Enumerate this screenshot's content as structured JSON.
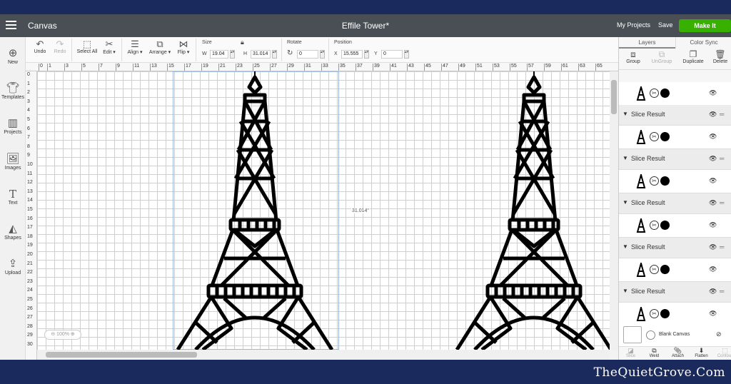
{
  "topbar": {
    "app_title": "Canvas",
    "document_title": "Effile Tower*",
    "my_projects": "My Projects",
    "save": "Save",
    "make_it": "Make It",
    "make_it_color": "#38b000"
  },
  "toolbar": {
    "undo": "Undo",
    "redo": "Redo",
    "select_all": "Select All",
    "edit": "Edit",
    "align": "Align",
    "arrange": "Arrange",
    "flip": "Flip",
    "size_label": "Size",
    "w_label": "W",
    "w_value": "19.04",
    "h_label": "H",
    "h_value": "31.014",
    "rotate_label": "Rotate",
    "rotate_value": "0",
    "position_label": "Position",
    "x_label": "X",
    "x_value": "15.555",
    "y_label": "Y",
    "y_value": "0"
  },
  "leftnav": {
    "items": [
      {
        "label": "New",
        "icon": "plus-circle-icon"
      },
      {
        "label": "Templates",
        "icon": "shirt-icon"
      },
      {
        "label": "Projects",
        "icon": "projects-icon"
      },
      {
        "label": "Images",
        "icon": "image-icon"
      },
      {
        "label": "Text",
        "icon": "text-icon"
      },
      {
        "label": "Shapes",
        "icon": "shapes-icon"
      },
      {
        "label": "Upload",
        "icon": "upload-icon"
      }
    ]
  },
  "rulers": {
    "h_ticks": [
      "0",
      "1",
      "3",
      "5",
      "7",
      "9",
      "11",
      "13",
      "15",
      "17",
      "19",
      "21",
      "23",
      "25",
      "27",
      "29",
      "31",
      "33",
      "35",
      "37",
      "39",
      "41",
      "43",
      "45",
      "47",
      "49",
      "51",
      "53",
      "55",
      "57",
      "59",
      "61",
      "63",
      "65"
    ],
    "v_ticks": [
      "0",
      "1",
      "2",
      "3",
      "4",
      "5",
      "6",
      "7",
      "8",
      "9",
      "10",
      "11",
      "12",
      "13",
      "14",
      "15",
      "16",
      "17",
      "18",
      "19",
      "20",
      "21",
      "22",
      "23",
      "24",
      "25",
      "26",
      "27",
      "28",
      "29",
      "30"
    ]
  },
  "canvas": {
    "dimension_label": "31.014\"",
    "zoom_label": "100%"
  },
  "panel": {
    "tab_layers": "Layers",
    "tab_color_sync": "Color Sync",
    "tools": {
      "group": "Group",
      "ungroup": "UnGroup",
      "duplicate": "Duplicate",
      "delete": "Delete"
    },
    "groups": [
      {
        "label": "Slice Result"
      },
      {
        "label": "Slice Result"
      },
      {
        "label": "Slice Result"
      },
      {
        "label": "Slice Result"
      },
      {
        "label": "Slice Result"
      }
    ],
    "blank_canvas": "Blank Canvas",
    "bottom": {
      "slice": "Slice",
      "weld": "Weld",
      "attach": "Attach",
      "flatten": "Flatten",
      "contour": "Contour"
    }
  },
  "footer": {
    "brand": "TheQuietGrove.Com"
  }
}
